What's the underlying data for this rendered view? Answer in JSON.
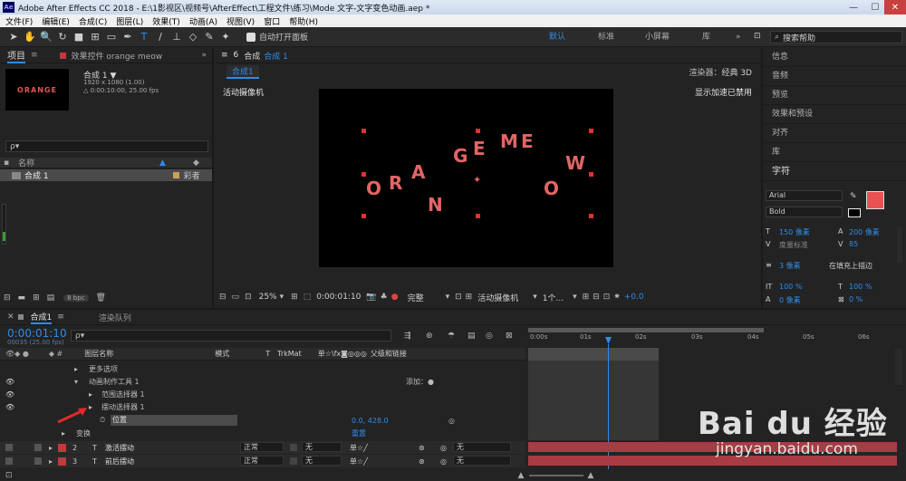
{
  "window": {
    "title": "Adobe After Effects CC 2018 - E:\\1影视区\\视频号\\AfterEffect\\工程文件\\练习\\Mode 文字-文字变色动画.aep *",
    "logo": "Ae",
    "min": "—",
    "max": "☐",
    "close": "✕"
  },
  "menu": [
    "文件(F)",
    "编辑(E)",
    "合成(C)",
    "图层(L)",
    "效果(T)",
    "动画(A)",
    "视图(V)",
    "窗口",
    "帮助(H)"
  ],
  "toolbar": {
    "auto_open_label": "自动打开面板",
    "workspaces": [
      "默认",
      "标准",
      "小屏幕",
      "库"
    ],
    "active_workspace": "默认",
    "search_placeholder": "搜索帮助",
    "more": "»"
  },
  "project": {
    "tab_label": "项目",
    "effects_tab": "效果控件 orange meow",
    "comp_name": "合成 1 ▼",
    "comp_size": "1920 x 1080 (1.00)",
    "comp_duration": "△ 0:00:10:00, 25.00 fps",
    "thumb_text": "ORANGE",
    "search_placeholder": "ρ▾",
    "col_name": "名称",
    "item_name": "合成 1",
    "item_type": "彩者",
    "bpc": "8 bpc"
  },
  "viewer": {
    "tab_label": "合成",
    "tab_comp": "合成 1",
    "breadcrumb": "合成1",
    "renderer_label": "渲染器：",
    "renderer_value": "经典 3D",
    "camera_label": "活动摄像机",
    "accel_label": "显示加速已禁用",
    "zoom": "25%",
    "timecode": "0:00:01:10",
    "quality": "完整",
    "camera_select": "活动摄像机",
    "views": "1个...",
    "exposure": "+0.0",
    "letters": [
      "O",
      "R",
      "A",
      "N",
      "G",
      "E",
      "M",
      "E",
      "O",
      "W"
    ]
  },
  "right_panel": {
    "items": [
      "信息",
      "音频",
      "预览",
      "效果和预设",
      "对齐",
      "库"
    ],
    "char_title": "字符",
    "font": "Arial",
    "style": "Bold",
    "font_size": "150 像素",
    "leading": "200 像素",
    "kerning": "度量标准",
    "tracking": "85",
    "stroke_width": "3 像素",
    "stroke_mode": "在填充上描边",
    "vscale": "100 %",
    "hscale": "100 %",
    "baseline": "0 像素",
    "tsume": "0 %",
    "fill_color": "#e85252"
  },
  "timeline": {
    "tab_comp": "合成1",
    "render_tab": "渲染队列",
    "timecode": "0:00:01:10",
    "frames": "00035 (25.00 fps)",
    "col_layer": "图层名称",
    "col_mode": "模式",
    "col_t": "T",
    "col_trkmat": "TrkMat",
    "col_parent": "父级和链接",
    "ruler": [
      "0:00s",
      "01s",
      "02s",
      "03s",
      "04s",
      "05s",
      "06s"
    ],
    "rows": [
      {
        "label": "更多选项"
      },
      {
        "label": "动画制作工具 1",
        "extra": "添加：●"
      },
      {
        "label": "范围选择器 1"
      },
      {
        "label": "摆动选择器 1"
      },
      {
        "label": "位置",
        "value": "0.0, 428.0"
      },
      {
        "label": "变换",
        "value": "重置"
      }
    ],
    "layers": [
      {
        "num": "2",
        "name": "激活摆动",
        "mode": "正常",
        "trk": "无",
        "parent": "无"
      },
      {
        "num": "3",
        "name": "前后摆动",
        "mode": "正常",
        "trk": "无",
        "parent": "无"
      }
    ],
    "watermark": "Bai du 经验",
    "watermark_url": "jingyan.baidu.com"
  }
}
